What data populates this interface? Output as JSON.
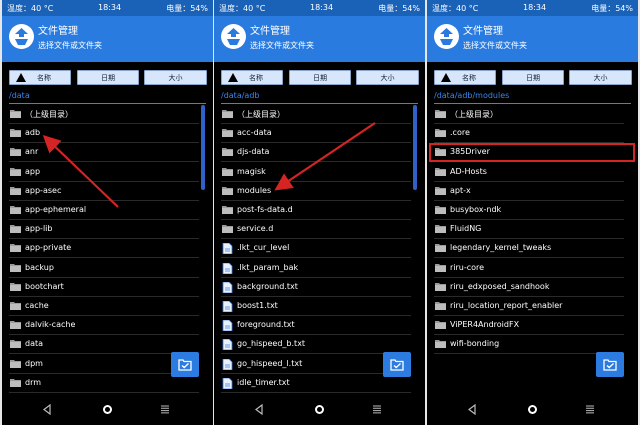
{
  "panels": [
    {
      "status": {
        "temp": "温度：40 °C",
        "time": "18:34",
        "battery": "电量：54%"
      },
      "header": {
        "title": "文件管理",
        "subtitle": "选择文件或文件夹"
      },
      "sort": {
        "name": "名称",
        "date": "日期",
        "size": "大小"
      },
      "path": "/data",
      "items": [
        {
          "name": "（上级目录）",
          "type": "folder"
        },
        {
          "name": "adb",
          "type": "folder"
        },
        {
          "name": "anr",
          "type": "folder"
        },
        {
          "name": "app",
          "type": "folder"
        },
        {
          "name": "app-asec",
          "type": "folder"
        },
        {
          "name": "app-ephemeral",
          "type": "folder"
        },
        {
          "name": "app-lib",
          "type": "folder"
        },
        {
          "name": "app-private",
          "type": "folder"
        },
        {
          "name": "backup",
          "type": "folder"
        },
        {
          "name": "bootchart",
          "type": "folder"
        },
        {
          "name": "cache",
          "type": "folder"
        },
        {
          "name": "dalvik-cache",
          "type": "folder"
        },
        {
          "name": "data",
          "type": "folder"
        },
        {
          "name": "dpm",
          "type": "folder"
        },
        {
          "name": "drm",
          "type": "folder"
        }
      ]
    },
    {
      "status": {
        "temp": "温度：40 °C",
        "time": "18:34",
        "battery": "电量：54%"
      },
      "header": {
        "title": "文件管理",
        "subtitle": "选择文件或文件夹"
      },
      "sort": {
        "name": "名称",
        "date": "日期",
        "size": "大小"
      },
      "path": "/data/adb",
      "items": [
        {
          "name": "（上级目录）",
          "type": "folder"
        },
        {
          "name": "acc-data",
          "type": "folder"
        },
        {
          "name": "djs-data",
          "type": "folder"
        },
        {
          "name": "magisk",
          "type": "folder"
        },
        {
          "name": "modules",
          "type": "folder"
        },
        {
          "name": "post-fs-data.d",
          "type": "folder"
        },
        {
          "name": "service.d",
          "type": "folder"
        },
        {
          "name": ".lkt_cur_level",
          "type": "file"
        },
        {
          "name": ".lkt_param_bak",
          "type": "file"
        },
        {
          "name": "background.txt",
          "type": "file"
        },
        {
          "name": "boost1.txt",
          "type": "file"
        },
        {
          "name": "foreground.txt",
          "type": "file"
        },
        {
          "name": "go_hispeed_b.txt",
          "type": "file"
        },
        {
          "name": "go_hispeed_l.txt",
          "type": "file"
        },
        {
          "name": "idle_timer.txt",
          "type": "file"
        }
      ]
    },
    {
      "status": {
        "temp": "温度：40 °C",
        "time": "18:34",
        "battery": "电量：54%"
      },
      "header": {
        "title": "文件管理",
        "subtitle": "选择文件或文件夹"
      },
      "sort": {
        "name": "名称",
        "date": "日期",
        "size": "大小"
      },
      "path": "/data/adb/modules",
      "items": [
        {
          "name": "（上级目录）",
          "type": "folder"
        },
        {
          "name": ".core",
          "type": "folder"
        },
        {
          "name": "385Driver",
          "type": "folder"
        },
        {
          "name": "AD-Hosts",
          "type": "folder"
        },
        {
          "name": "apt-x",
          "type": "folder"
        },
        {
          "name": "busybox-ndk",
          "type": "folder"
        },
        {
          "name": "FluidNG",
          "type": "folder"
        },
        {
          "name": "legendary_kernel_tweaks",
          "type": "folder"
        },
        {
          "name": "riru-core",
          "type": "folder"
        },
        {
          "name": "riru_edxposed_sandhook",
          "type": "folder"
        },
        {
          "name": "riru_location_report_enabler",
          "type": "folder"
        },
        {
          "name": "ViPER4AndroidFX",
          "type": "folder"
        },
        {
          "name": "wifi-bonding",
          "type": "folder"
        }
      ]
    }
  ],
  "colors": {
    "accent": "#2a7be0",
    "status_bar": "#1a62b8",
    "annotation": "#d42424",
    "path_text": "#3a86ea"
  },
  "icons": {
    "folder": "folder-icon",
    "file": "file-icon",
    "logo": "app-logo-icon",
    "fab": "confirm-folder-icon"
  }
}
